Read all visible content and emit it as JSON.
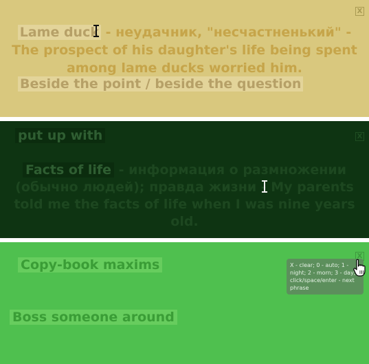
{
  "panels": [
    {
      "close": "X",
      "lines": [
        {
          "term": "Lame duck",
          "rest": " - неудачник, \"несчастненький\" -"
        },
        {
          "text": "The prospect of his daughter's life being spent"
        },
        {
          "text": "among lame ducks worried him."
        },
        {
          "term": "Beside the point / beside the question"
        }
      ]
    },
    {
      "close": "X",
      "lines": [
        {
          "term": "put up with"
        },
        {
          "term": "Facts of life",
          "rest": " - информация о размножении"
        },
        {
          "text": "(обычно людей); правда жизни - My parents"
        },
        {
          "text": "told me the facts of life when I was nine years"
        },
        {
          "text": "old."
        }
      ]
    },
    {
      "close": "X",
      "lines": [
        {
          "term": "Copy-book maxims"
        },
        {
          "term": "Boss someone around"
        }
      ]
    }
  ],
  "tooltip": {
    "text": "X - clear; 0 - auto; 1 - night; 2 - morn; 3 - day; click/space/enter - next phrase"
  },
  "colors": {
    "panel1_bg": "#d9c87e",
    "panel2_bg": "#0e3412",
    "panel3_bg": "#4fc04f",
    "tooltip_bg": "#5c8f5c"
  },
  "icons": [
    "close-icon",
    "text-cursor-icon",
    "hand-pointer-icon"
  ]
}
